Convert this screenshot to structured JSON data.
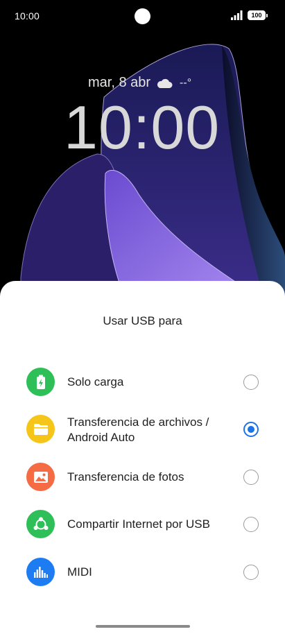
{
  "status_bar": {
    "time": "10:00",
    "battery": "100",
    "icons": [
      "camera-hole",
      "signal-icon",
      "battery-icon"
    ]
  },
  "lock_screen": {
    "date": "mar, 8 abr",
    "weather_icon": "cloud-icon",
    "temperature": "--°",
    "clock": "10:00"
  },
  "sheet": {
    "title": "Usar USB para",
    "options": [
      {
        "label": "Solo carga",
        "icon": "battery-charge-icon",
        "color": "#2fbf58",
        "checked": false
      },
      {
        "label": "Transferencia de archivos / Android Auto",
        "icon": "folder-icon",
        "color": "#f6c519",
        "checked": true
      },
      {
        "label": "Transferencia de fotos",
        "icon": "photo-icon",
        "color": "#f56b44",
        "checked": false
      },
      {
        "label": "Compartir Internet por USB",
        "icon": "share-network-icon",
        "color": "#2fbf58",
        "checked": false
      },
      {
        "label": "MIDI",
        "icon": "equalizer-icon",
        "color": "#1e7cf2",
        "checked": false
      }
    ]
  },
  "colors": {
    "accent": "#1a73e8",
    "sheet_background": "#ffffff",
    "wallpaper_purple": "#5a36b8"
  }
}
